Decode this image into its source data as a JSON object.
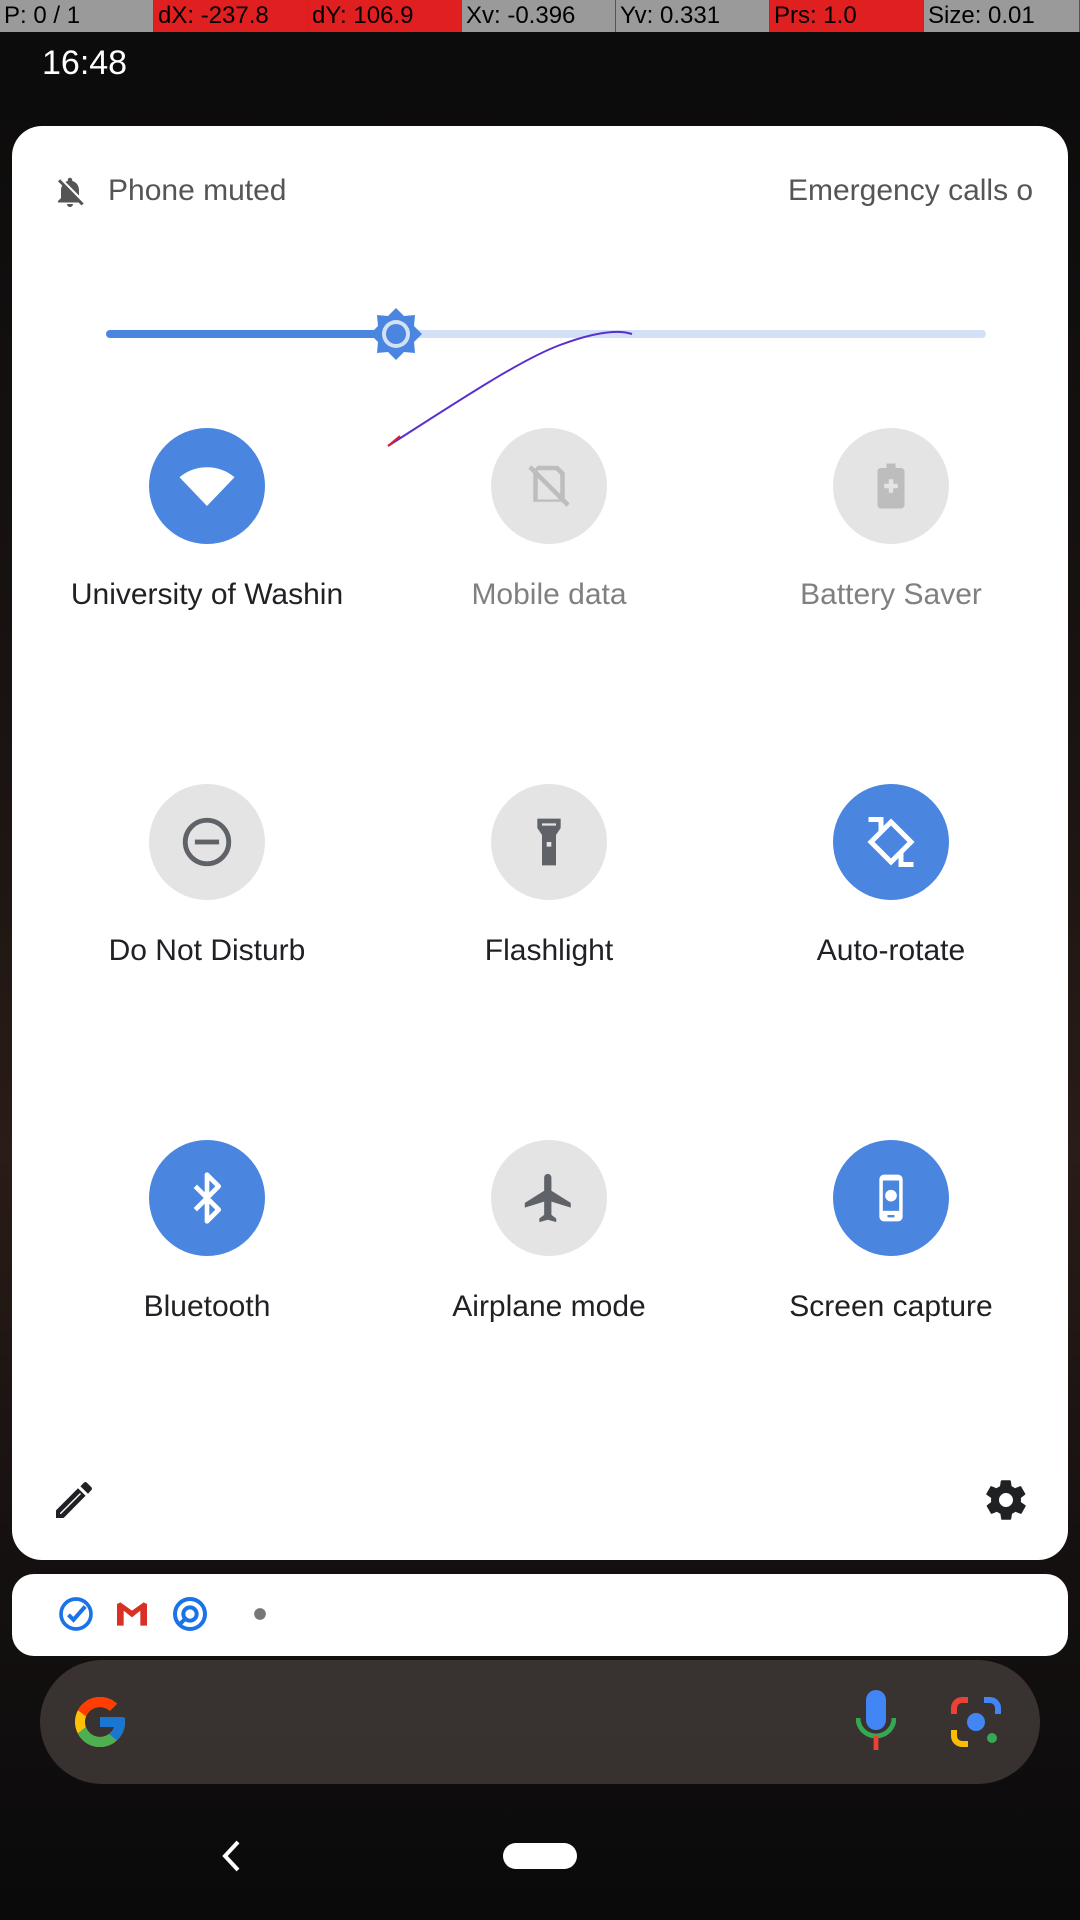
{
  "debug_bar": {
    "pointer": "P: 0 / 1",
    "dx": "dX: -237.8",
    "dy": "dY: 106.9",
    "xv": "Xv: -0.396",
    "yv": "Yv: 0.331",
    "prs": "Prs: 1.0",
    "size": "Size: 0.01"
  },
  "status_bar": {
    "time": "16:48"
  },
  "quick_settings": {
    "header": {
      "mute_label": "Phone muted",
      "emergency_label": "Emergency calls o"
    },
    "brightness": {
      "level": 0.33,
      "icon": "brightness-icon"
    },
    "tiles": [
      {
        "label": "University of Washin",
        "icon": "wifi-icon",
        "state": "on"
      },
      {
        "label": "Mobile data",
        "icon": "mobile-data-off-icon",
        "state": "unavailable"
      },
      {
        "label": "Battery Saver",
        "icon": "battery-saver-icon",
        "state": "unavailable"
      },
      {
        "label": "Do Not Disturb",
        "icon": "do-not-disturb-icon",
        "state": "off"
      },
      {
        "label": "Flashlight",
        "icon": "flashlight-icon",
        "state": "off"
      },
      {
        "label": "Auto-rotate",
        "icon": "auto-rotate-icon",
        "state": "on"
      },
      {
        "label": "Bluetooth",
        "icon": "bluetooth-icon",
        "state": "on"
      },
      {
        "label": "Airplane mode",
        "icon": "airplane-icon",
        "state": "off"
      },
      {
        "label": "Screen capture",
        "icon": "screen-capture-icon",
        "state": "on"
      }
    ],
    "footer": {
      "edit_icon": "edit-icon",
      "settings_icon": "gear-icon"
    }
  },
  "notification_icons": [
    "tasks-check-icon",
    "gmail-icon",
    "app-icon",
    "more-dot-icon"
  ],
  "search_bar": {
    "logo": "google-logo-icon",
    "mic": "mic-icon",
    "lens": "lens-icon"
  },
  "nav_bar": {
    "back": "back-icon",
    "home": "home-pill"
  },
  "colors": {
    "accent": "#4a86e0",
    "tile_off": "#e4e4e4",
    "debug_red": "#e02020",
    "debug_gray": "#9a9a9a"
  }
}
